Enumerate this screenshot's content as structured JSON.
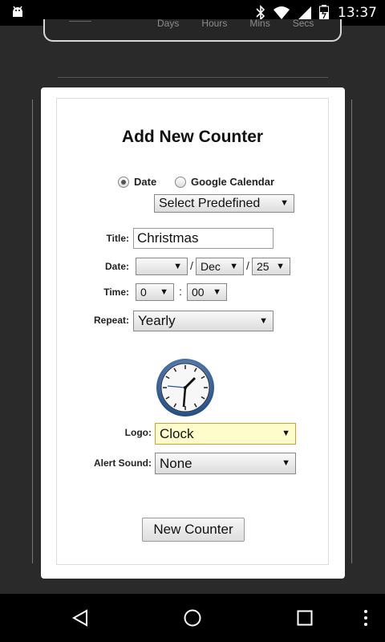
{
  "status_bar": {
    "time": "13:37",
    "icons": [
      "android-icon",
      "bluetooth-icon",
      "wifi-icon",
      "signal-icon",
      "battery-icon"
    ]
  },
  "top_card": {
    "labels": [
      "Days",
      "Hours",
      "Mins",
      "Secs"
    ]
  },
  "form": {
    "heading": "Add New Counter",
    "radio_date_label": "Date",
    "radio_google_label": "Google Calendar",
    "predefined_select": "Select Predefined",
    "title_label": "Title:",
    "title_value": "Christmas",
    "date_label": "Date:",
    "date_month": "Dec",
    "date_day": "25",
    "date_year": "",
    "time_label": "Time:",
    "time_hour": "0",
    "time_minute": "00",
    "time_separator": ":",
    "date_separator": "/",
    "repeat_label": "Repeat:",
    "repeat_value": "Yearly",
    "logo_label": "Logo:",
    "logo_value": "Clock",
    "alert_label": "Alert Sound:",
    "alert_value": "None",
    "submit_label": "New Counter",
    "selected_radio": "Date",
    "logo_select_color": "#fffccc",
    "logo_select_border": "#d4a02a"
  }
}
